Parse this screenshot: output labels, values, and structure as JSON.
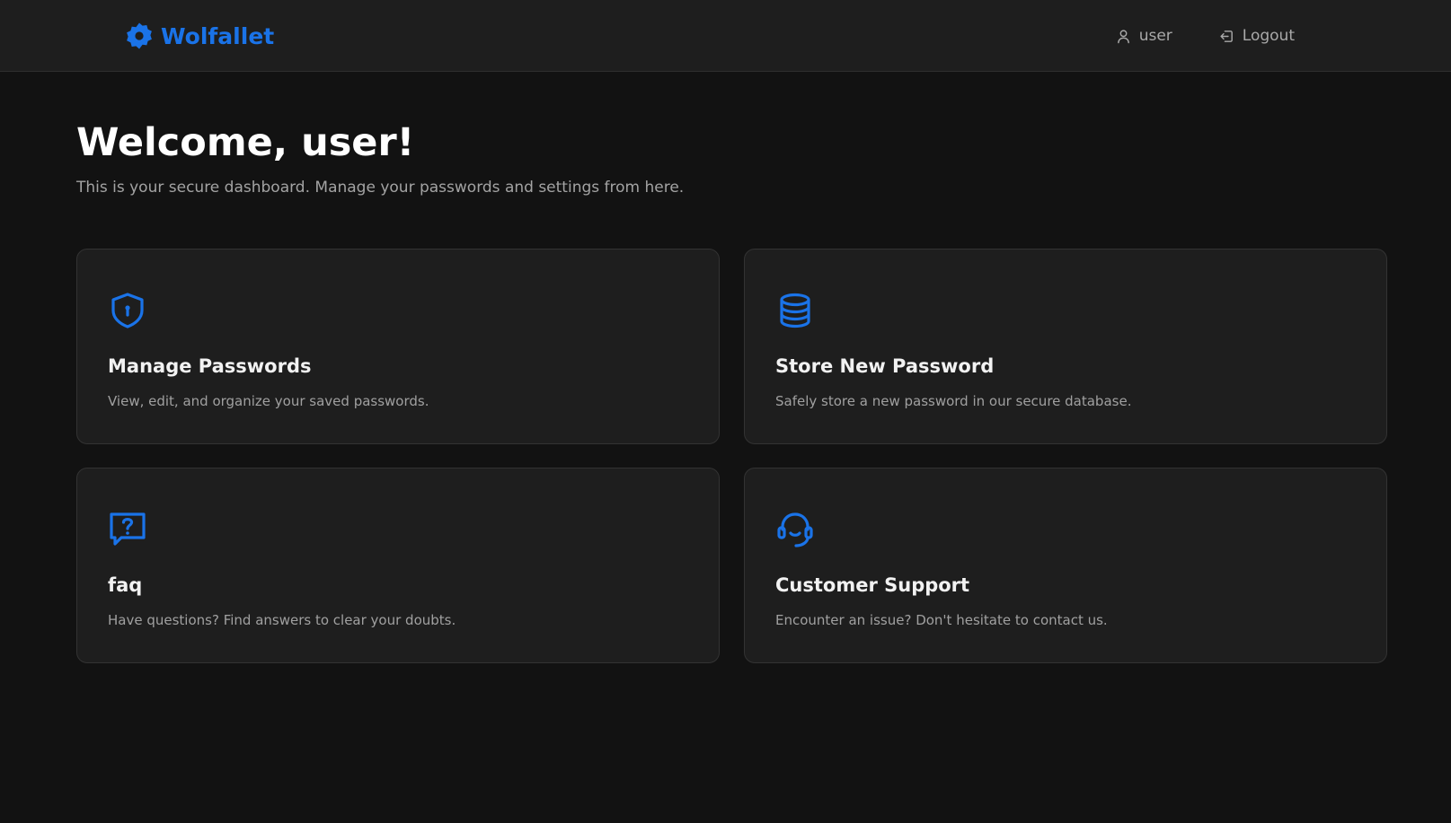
{
  "colors": {
    "accent": "#1a73e8",
    "background": "#121212",
    "surface": "#1e1e1e",
    "border": "#333333",
    "muted_text": "#a3a3a3"
  },
  "navbar": {
    "brand": {
      "name": "Wolfallet",
      "icon": "gear-badge-icon"
    },
    "user": {
      "label": "user",
      "icon": "user-icon"
    },
    "logout": {
      "label": "Logout",
      "icon": "logout-icon"
    }
  },
  "main": {
    "title": "Welcome, user!",
    "subtitle": "This is your secure dashboard. Manage your passwords and settings from here.",
    "cards": [
      {
        "icon": "shield-keyhole-icon",
        "title": "Manage Passwords",
        "description": "View, edit, and organize your saved passwords."
      },
      {
        "icon": "database-icon",
        "title": "Store New Password",
        "description": "Safely store a new password in our secure database."
      },
      {
        "icon": "question-chat-icon",
        "title": "faq",
        "description": "Have questions? Find answers to clear your doubts."
      },
      {
        "icon": "headset-icon",
        "title": "Customer Support",
        "description": "Encounter an issue? Don't hesitate to contact us."
      }
    ]
  }
}
